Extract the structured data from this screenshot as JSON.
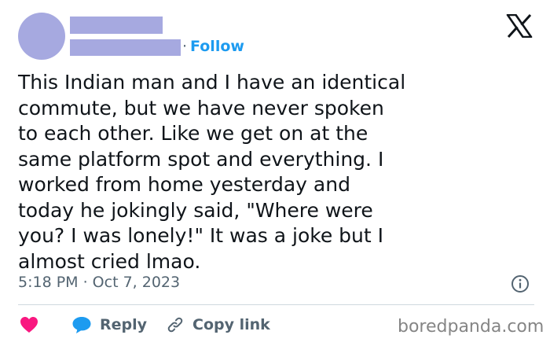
{
  "header": {
    "follow_separator": "·",
    "follow_label": "Follow"
  },
  "tweet": {
    "text": "This Indian man and I have an identical\ncommute, but we have never spoken\nto each other. Like we get on at the\nsame platform spot and everything. I\nworked from home yesterday and\ntoday he jokingly said, \"Where were\nyou? I was lonely!\" It was a joke but I\nalmost cried lmao.",
    "timestamp": "5:18 PM · Oct 7, 2023"
  },
  "actions": {
    "reply_label": "Reply",
    "copy_link_label": "Copy link"
  },
  "watermark": "boredpanda.com",
  "icons": {
    "brand": "x-logo-icon",
    "info": "info-icon",
    "like": "heart-icon",
    "reply": "speech-bubble-icon",
    "copy": "link-icon"
  },
  "colors": {
    "avatar_placeholder": "#a6a9e0",
    "accent": "#1d9bf0",
    "heart": "#f91880",
    "secondary_text": "#536471"
  }
}
